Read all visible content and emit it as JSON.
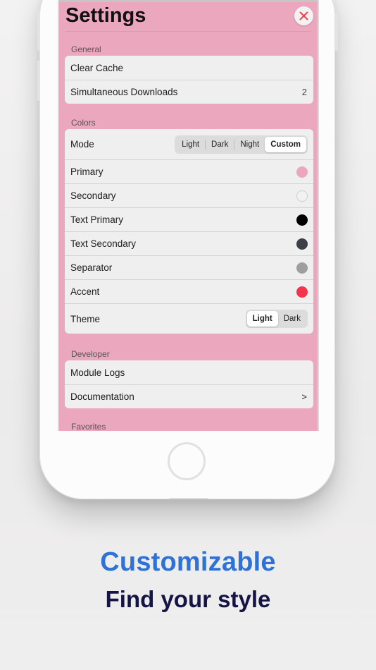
{
  "settings": {
    "title": "Settings",
    "sections": {
      "general": {
        "header": "General",
        "clear_cache": "Clear Cache",
        "simultaneous_downloads": {
          "label": "Simultaneous Downloads",
          "value": "2"
        }
      },
      "colors": {
        "header": "Colors",
        "mode": {
          "label": "Mode",
          "options": [
            "Light",
            "Dark",
            "Night",
            "Custom"
          ],
          "selected": "Custom"
        },
        "primary": {
          "label": "Primary",
          "color": "#eaa7be"
        },
        "secondary": {
          "label": "Secondary",
          "color": "#f2f2f2"
        },
        "text_primary": {
          "label": "Text Primary",
          "color": "#000000"
        },
        "text_secondary": {
          "label": "Text Secondary",
          "color": "#3c3f47"
        },
        "separator": {
          "label": "Separator",
          "color": "#9e9e9e"
        },
        "accent": {
          "label": "Accent",
          "color": "#f5334b"
        },
        "theme": {
          "label": "Theme",
          "options": [
            "Light",
            "Dark"
          ],
          "selected": "Light"
        }
      },
      "developer": {
        "header": "Developer",
        "module_logs": "Module Logs",
        "documentation": {
          "label": "Documentation",
          "chevron": ">"
        }
      },
      "favorites": {
        "header": "Favorites"
      }
    },
    "close_icon": "close-x-icon",
    "close_icon_color": "#e6474f"
  },
  "promo": {
    "headline": "Customizable",
    "subline": "Find your style",
    "headline_color": "#2f72d6",
    "subline_color": "#141544"
  }
}
